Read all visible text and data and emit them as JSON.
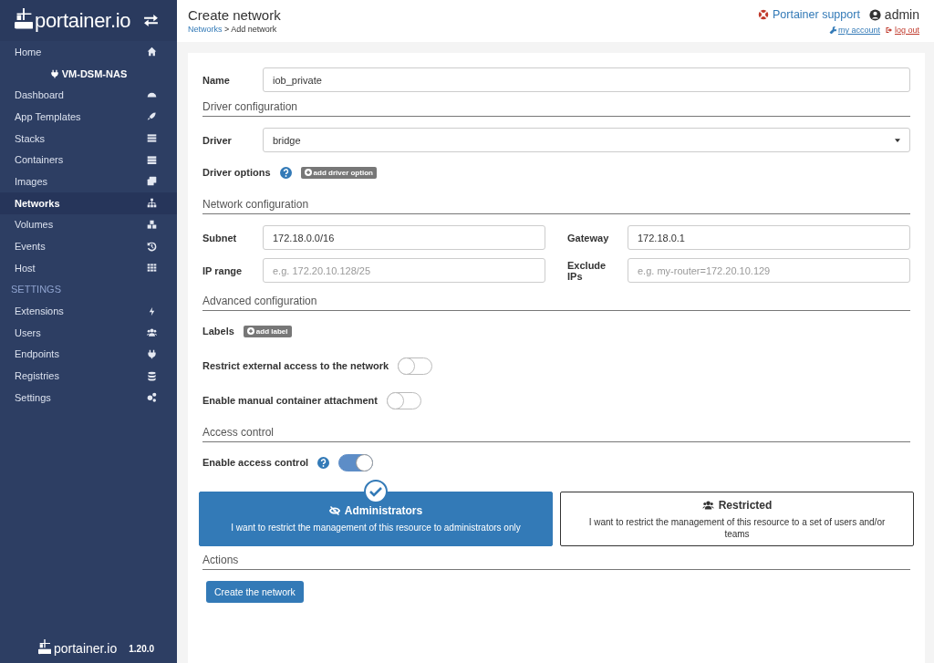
{
  "sidebar": {
    "logo": "portainer.io",
    "home": {
      "label": "Home",
      "selected": false
    },
    "endpoint": "VM-DSM-NAS",
    "endpoint_items": [
      {
        "label": "Dashboard",
        "selected": false
      },
      {
        "label": "App Templates",
        "selected": false
      },
      {
        "label": "Stacks",
        "selected": false
      },
      {
        "label": "Containers",
        "selected": false
      },
      {
        "label": "Images",
        "selected": false
      },
      {
        "label": "Networks",
        "selected": true
      },
      {
        "label": "Volumes",
        "selected": false
      },
      {
        "label": "Events",
        "selected": false
      },
      {
        "label": "Host",
        "selected": false
      }
    ],
    "settings_heading": "SETTINGS",
    "settings_items": [
      {
        "label": "Extensions",
        "selected": false
      },
      {
        "label": "Users",
        "selected": false
      },
      {
        "label": "Endpoints",
        "selected": false
      },
      {
        "label": "Registries",
        "selected": false
      },
      {
        "label": "Settings",
        "selected": false
      }
    ],
    "footer": {
      "logo": "portainer.io",
      "version": "1.20.0"
    }
  },
  "header": {
    "title": "Create network",
    "breadcrumb_link": "Networks",
    "breadcrumb_current": "> Add network",
    "support": "Portainer support",
    "user": "admin",
    "my_account": "my account",
    "log_out": "log out"
  },
  "form": {
    "name": {
      "label": "Name",
      "value": "iob_private"
    },
    "driver_section": "Driver configuration",
    "driver": {
      "label": "Driver",
      "value": "bridge"
    },
    "driver_options": {
      "label": "Driver options",
      "button": "add driver option"
    },
    "network_section": "Network configuration",
    "subnet": {
      "label": "Subnet",
      "value": "172.18.0.0/16"
    },
    "gateway": {
      "label": "Gateway",
      "value": "172.18.0.1"
    },
    "ip_range": {
      "label": "IP range",
      "placeholder": "e.g. 172.20.10.128/25"
    },
    "exclude_ips": {
      "label": "Exclude IPs",
      "placeholder": "e.g. my-router=172.20.10.129"
    },
    "advanced_section": "Advanced configuration",
    "labels": {
      "label": "Labels",
      "button": "add label"
    },
    "restrict_external": {
      "label": "Restrict external access to the network",
      "on": false
    },
    "manual_attachment": {
      "label": "Enable manual container attachment",
      "on": false
    },
    "access_section": "Access control",
    "access_control": {
      "label": "Enable access control",
      "on": true
    },
    "access_options": [
      {
        "title": "Administrators",
        "description": "I want to restrict the management of this resource to administrators only",
        "selected": true
      },
      {
        "title": "Restricted",
        "description": "I want to restrict the management of this resource to a set of users and/or teams",
        "selected": false
      }
    ],
    "actions_section": "Actions",
    "submit": "Create the network"
  }
}
